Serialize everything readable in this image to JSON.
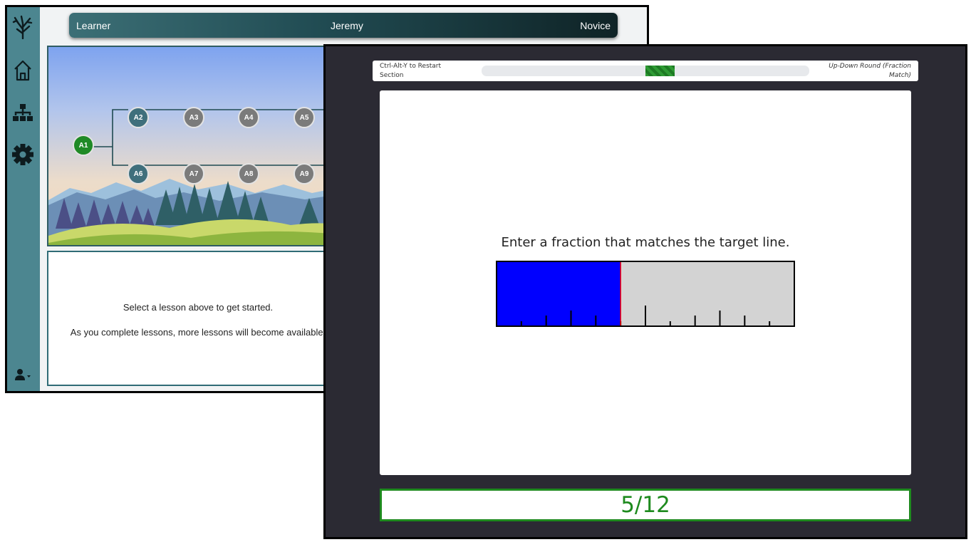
{
  "back_window": {
    "header": {
      "role": "Learner",
      "name": "Jeremy",
      "level": "Novice"
    },
    "sidebar": {
      "icons": [
        "tree-logo-icon",
        "home-icon",
        "sitemap-icon",
        "gear-icon",
        "user-icon"
      ]
    },
    "lessons": {
      "root": {
        "label": "A1",
        "status": "done"
      },
      "row1": [
        {
          "label": "A2",
          "status": "open"
        },
        {
          "label": "A3",
          "status": "locked"
        },
        {
          "label": "A4",
          "status": "locked"
        },
        {
          "label": "A5",
          "status": "locked"
        }
      ],
      "row2": [
        {
          "label": "A6",
          "status": "open"
        },
        {
          "label": "A7",
          "status": "locked"
        },
        {
          "label": "A8",
          "status": "locked"
        },
        {
          "label": "A9",
          "status": "locked"
        }
      ]
    },
    "message": {
      "line1": "Select a lesson above to get started.",
      "line2": "As you complete lessons, more lessons will become available."
    }
  },
  "front_window": {
    "status": {
      "restart_hint": "Ctrl-Alt-Y to Restart Section",
      "round_label": "Up-Down Round (Fraction Match)",
      "progress": {
        "start": 0.5,
        "end": 0.59
      }
    },
    "prompt": "Enter a fraction that matches the target line.",
    "fraction_bar": {
      "target_fraction": 0.4167,
      "filled_color": "#0000ff",
      "empty_color": "#d3d3d3",
      "target_line_color": "#ff0000",
      "ticks": [
        {
          "pos": 0.0833,
          "size": "small"
        },
        {
          "pos": 0.1667,
          "size": "medium"
        },
        {
          "pos": 0.25,
          "size": "large"
        },
        {
          "pos": 0.3333,
          "size": "medium"
        },
        {
          "pos": 0.4167,
          "size": "small"
        },
        {
          "pos": 0.5,
          "size": "xlarge"
        },
        {
          "pos": 0.5833,
          "size": "small"
        },
        {
          "pos": 0.6667,
          "size": "medium"
        },
        {
          "pos": 0.75,
          "size": "large"
        },
        {
          "pos": 0.8333,
          "size": "medium"
        },
        {
          "pos": 0.9167,
          "size": "small"
        }
      ]
    },
    "answer": {
      "value": "5/12",
      "color": "#1e8a1e"
    }
  }
}
